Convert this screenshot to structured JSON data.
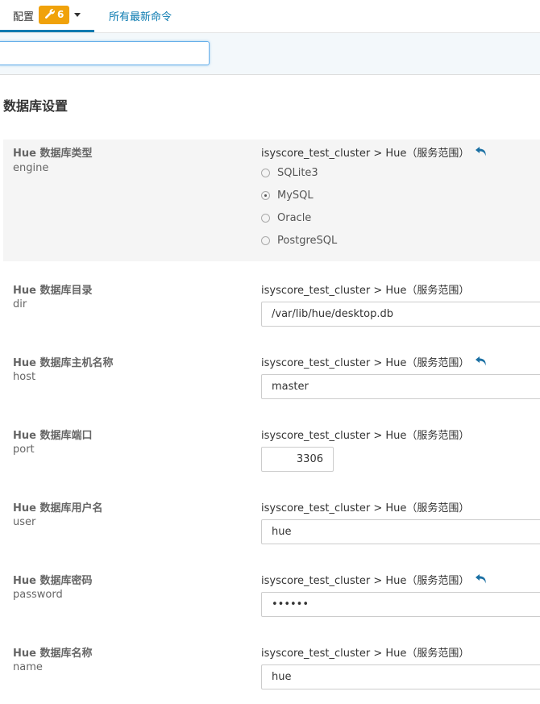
{
  "tabs": {
    "config_label": "配置",
    "config_badge": "6",
    "commands_label": "所有最新命令"
  },
  "search": {
    "value": "",
    "placeholder": ""
  },
  "section_title": "数据库设置",
  "colors": {
    "accent": "#0a7ab0",
    "badge": "#f0a20b",
    "undo_icon": "#1a6fa3"
  },
  "engine": {
    "label": "Hue 数据库类型",
    "key": "engine",
    "scope": "isyscore_test_cluster > Hue（服务范围）",
    "options": [
      "SQLite3",
      "MySQL",
      "Oracle",
      "PostgreSQL"
    ],
    "selected": "MySQL"
  },
  "dir": {
    "label": "Hue 数据库目录",
    "key": "dir",
    "scope": "isyscore_test_cluster > Hue（服务范围）",
    "value": "/var/lib/hue/desktop.db"
  },
  "host": {
    "label": "Hue 数据库主机名称",
    "key": "host",
    "scope": "isyscore_test_cluster > Hue（服务范围）",
    "value": "master"
  },
  "port": {
    "label": "Hue 数据库端口",
    "key": "port",
    "scope": "isyscore_test_cluster > Hue（服务范围）",
    "value": "3306"
  },
  "user": {
    "label": "Hue 数据库用户名",
    "key": "user",
    "scope": "isyscore_test_cluster > Hue（服务范围）",
    "value": "hue"
  },
  "password": {
    "label": "Hue 数据库密码",
    "key": "password",
    "scope": "isyscore_test_cluster > Hue（服务范围）",
    "value": "••••••"
  },
  "name": {
    "label": "Hue 数据库名称",
    "key": "name",
    "scope": "isyscore_test_cluster > Hue（服务范围）",
    "value": "hue"
  }
}
